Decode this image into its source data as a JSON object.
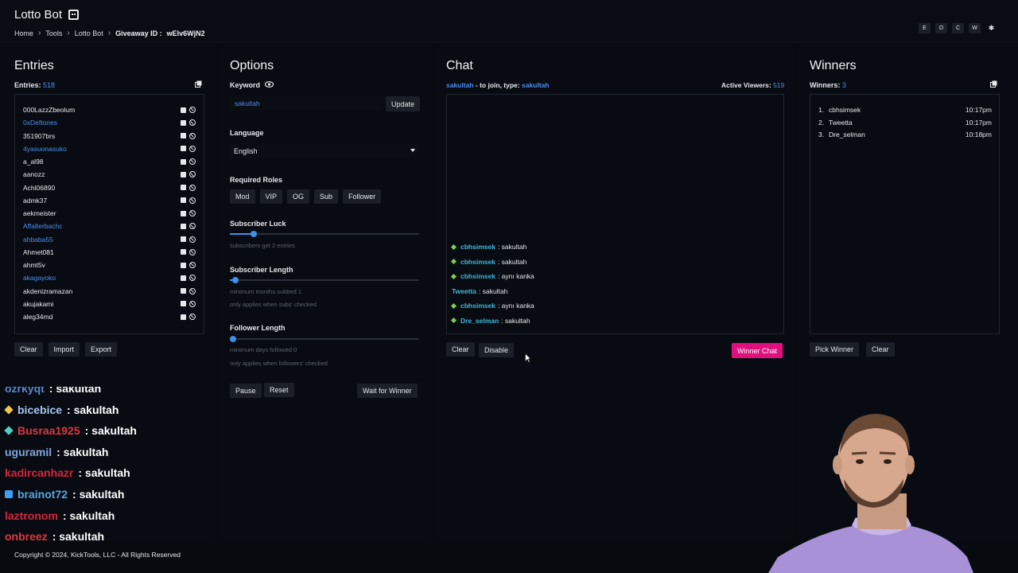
{
  "header": {
    "app_title": "Lotto Bot",
    "breadcrumb": [
      "Home",
      "Tools",
      "Lotto Bot"
    ],
    "giveaway_label": "Giveaway ID :",
    "giveaway_id": "wElv6WjN2",
    "top_buttons": [
      "E",
      "O",
      "C",
      "W"
    ],
    "settings_glyph": "✱"
  },
  "entries": {
    "title": "Entries",
    "count_label": "Entries:",
    "count": "518",
    "items": [
      {
        "name": "000LazzZbeolum",
        "color": "#e6e8eb"
      },
      {
        "name": "0xDeftones",
        "color": "#4d8ef0"
      },
      {
        "name": "351907brs",
        "color": "#e6e8eb"
      },
      {
        "name": "4yasuonasuko",
        "color": "#4d8ef0"
      },
      {
        "name": "a_al98",
        "color": "#e6e8eb"
      },
      {
        "name": "aanozz",
        "color": "#e6e8eb"
      },
      {
        "name": "Achl06890",
        "color": "#e6e8eb"
      },
      {
        "name": "admk37",
        "color": "#e6e8eb"
      },
      {
        "name": "aekmeister",
        "color": "#e6e8eb"
      },
      {
        "name": "Affalterbachc",
        "color": "#4d8ef0"
      },
      {
        "name": "ahbaba55",
        "color": "#4d8ef0"
      },
      {
        "name": "Ahmet081",
        "color": "#e6e8eb"
      },
      {
        "name": "ahmt5v",
        "color": "#e6e8eb"
      },
      {
        "name": "akagayoko",
        "color": "#4d8ef0"
      },
      {
        "name": "akdenizramazan",
        "color": "#e6e8eb"
      },
      {
        "name": "akujakami",
        "color": "#e6e8eb"
      },
      {
        "name": "aleg34md",
        "color": "#e6e8eb"
      }
    ],
    "buttons": {
      "clear": "Clear",
      "import": "Import",
      "export": "Export"
    }
  },
  "options": {
    "title": "Options",
    "keyword_label": "Keyword",
    "keyword_value": "sakultah",
    "update_label": "Update",
    "language_label": "Language",
    "language_value": "English",
    "roles_label": "Required Roles",
    "roles": [
      "Mod",
      "VIP",
      "OG",
      "Sub",
      "Follower"
    ],
    "sub_luck_label": "Subscriber Luck",
    "sub_luck_hint": "subscribers get 2 entries",
    "sub_luck_level": 0.125,
    "sub_length_label": "Subscriber Length",
    "sub_length_hint": "minimum months subbed 1",
    "sub_length_hint2": "only applies when subs' checked",
    "sub_length_level": 0.03,
    "follower_length_label": "Follower Length",
    "follower_length_hint": "minimum days followed 0",
    "follower_length_hint2": "only applies when followers' checked",
    "follower_length_level": 0.0,
    "buttons": {
      "pause": "Pause",
      "reset": "Reset",
      "wait": "Wait for Winner"
    }
  },
  "chat": {
    "title": "Chat",
    "channel": "sakultah",
    "join_text": "- to join, type:",
    "join_keyword": "sakultah",
    "viewers_label": "Active Viewers:",
    "viewers": "519",
    "messages": [
      {
        "user": "cbhsimsek",
        "text": ": sakultah",
        "badge": true
      },
      {
        "user": "cbhsimsek",
        "text": ": sakultah",
        "badge": true
      },
      {
        "user": "cbhsimsek",
        "text": ": aynı kanka",
        "badge": true
      },
      {
        "user": "Tweetta",
        "text": ": sakultah",
        "badge": false
      },
      {
        "user": "cbhsimsek",
        "text": ": aynı kanka",
        "badge": true
      },
      {
        "user": "Dre_selman",
        "text": ": sakultah",
        "badge": true
      }
    ],
    "buttons": {
      "clear": "Clear",
      "disable": "Disable",
      "winner_chat": "Winner Chat"
    },
    "accent": "#e0107f"
  },
  "winners": {
    "title": "Winners",
    "count_label": "Winners:",
    "count": "3",
    "items": [
      {
        "rank": "1.",
        "name": "cbhsimsek",
        "time": "10:17pm"
      },
      {
        "rank": "2.",
        "name": "Tweetta",
        "time": "10:17pm"
      },
      {
        "rank": "3.",
        "name": "Dre_selman",
        "time": "10:18pm"
      }
    ],
    "buttons": {
      "pick": "Pick Winner",
      "clear": "Clear"
    }
  },
  "stream_chat": {
    "messages": [
      {
        "user": "ozrkyqt",
        "text": ": sakultah",
        "color": "#5d85c9",
        "icon": "none"
      },
      {
        "user": "bicebice",
        "text": ": sakultah",
        "color": "#a7c7f2",
        "icon": "diamond-yellow"
      },
      {
        "user": "Busraa1925",
        "text": ": sakultah",
        "color": "#e0363f",
        "icon": "diamond-teal"
      },
      {
        "user": "uguramil",
        "text": ": sakultah",
        "color": "#7fa6d9",
        "icon": "none"
      },
      {
        "user": "kadircanhazr",
        "text": ": sakultah",
        "color": "#d8243c",
        "icon": "none"
      },
      {
        "user": "brainot72",
        "text": ": sakultah",
        "color": "#5aa6e0",
        "icon": "cube-blue"
      },
      {
        "user": "laztronom",
        "text": ": sakultah",
        "color": "#d8243c",
        "icon": "none"
      },
      {
        "user": "onbreez",
        "text": ": sakultah",
        "color": "#e0363f",
        "icon": "none"
      }
    ]
  },
  "footer": {
    "copyright": "Copyright © 2024, KickTools, LLC - All Rights Reserved"
  }
}
